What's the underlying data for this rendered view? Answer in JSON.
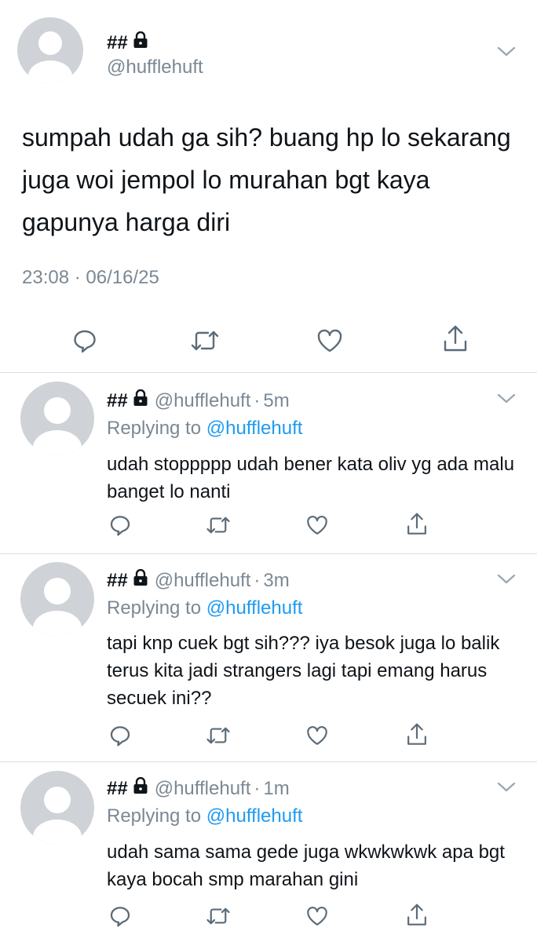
{
  "main_tweet": {
    "display_name": "##",
    "handle": "@hufflehuft",
    "text": "sumpah udah ga sih? buang hp lo sekarang juga woi jempol lo murahan bgt kaya gapunya harga diri",
    "time": "23:08 · 06/16/25"
  },
  "replies": [
    {
      "display_name": "##",
      "handle": "@hufflehuft",
      "age": "5m",
      "replying_label": "Replying to",
      "replying_to": "@hufflehuft",
      "text": "udah stoppppp udah bener kata oliv yg ada malu banget lo nanti"
    },
    {
      "display_name": "##",
      "handle": "@hufflehuft",
      "age": "3m",
      "replying_label": "Replying to",
      "replying_to": "@hufflehuft",
      "text": "tapi knp cuek bgt sih??? iya besok juga lo balik terus kita jadi strangers lagi tapi emang harus secuek ini??"
    },
    {
      "display_name": "##",
      "handle": "@hufflehuft",
      "age": "1m",
      "replying_label": "Replying to",
      "replying_to": "@hufflehuft",
      "text": "udah sama sama gede juga wkwkwkwk apa bgt kaya bocah smp marahan gini"
    }
  ],
  "icons": {
    "reply": "reply-bubble-icon",
    "retweet": "retweet-icon",
    "like": "heart-icon",
    "share": "share-icon",
    "lock": "lock-icon",
    "more": "chevron-down-icon"
  },
  "colors": {
    "text": "#0f1419",
    "muted": "#7b8894",
    "link": "#1d9bf0",
    "avatar": "#cfd2d6",
    "divider": "#d9dde1"
  }
}
